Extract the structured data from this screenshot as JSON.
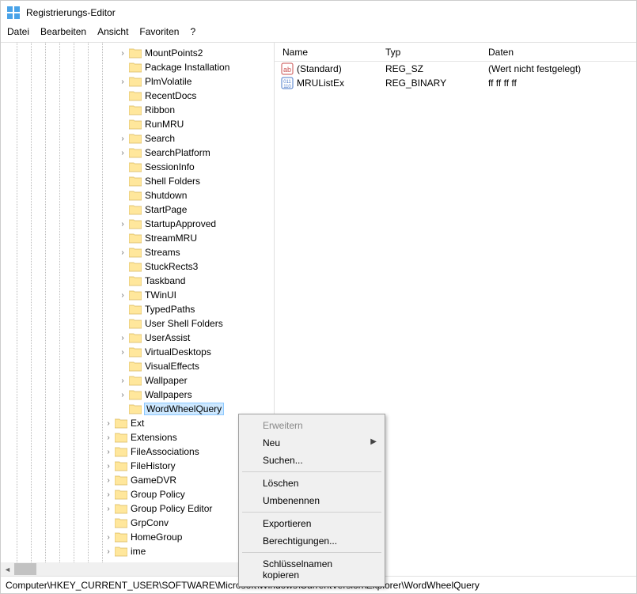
{
  "window": {
    "title": "Registrierungs-Editor"
  },
  "menu": {
    "file": "Datei",
    "edit": "Bearbeiten",
    "view": "Ansicht",
    "favorites": "Favoriten",
    "help": "?"
  },
  "tree": {
    "itemsTop": [
      {
        "label": "MountPoints2",
        "expander": ">",
        "indent": 148
      },
      {
        "label": "Package Installation",
        "expander": "",
        "indent": 148
      },
      {
        "label": "PlmVolatile",
        "expander": ">",
        "indent": 148
      },
      {
        "label": "RecentDocs",
        "expander": "",
        "indent": 148
      },
      {
        "label": "Ribbon",
        "expander": "",
        "indent": 148
      },
      {
        "label": "RunMRU",
        "expander": "",
        "indent": 148
      },
      {
        "label": "Search",
        "expander": ">",
        "indent": 148
      },
      {
        "label": "SearchPlatform",
        "expander": ">",
        "indent": 148
      },
      {
        "label": "SessionInfo",
        "expander": "",
        "indent": 148
      },
      {
        "label": "Shell Folders",
        "expander": "",
        "indent": 148
      },
      {
        "label": "Shutdown",
        "expander": "",
        "indent": 148
      },
      {
        "label": "StartPage",
        "expander": "",
        "indent": 148
      },
      {
        "label": "StartupApproved",
        "expander": ">",
        "indent": 148
      },
      {
        "label": "StreamMRU",
        "expander": "",
        "indent": 148
      },
      {
        "label": "Streams",
        "expander": ">",
        "indent": 148
      },
      {
        "label": "StuckRects3",
        "expander": "",
        "indent": 148
      },
      {
        "label": "Taskband",
        "expander": "",
        "indent": 148
      },
      {
        "label": "TWinUI",
        "expander": ">",
        "indent": 148
      },
      {
        "label": "TypedPaths",
        "expander": "",
        "indent": 148
      },
      {
        "label": "User Shell Folders",
        "expander": "",
        "indent": 148
      },
      {
        "label": "UserAssist",
        "expander": ">",
        "indent": 148
      },
      {
        "label": "VirtualDesktops",
        "expander": ">",
        "indent": 148
      },
      {
        "label": "VisualEffects",
        "expander": "",
        "indent": 148
      },
      {
        "label": "Wallpaper",
        "expander": ">",
        "indent": 148
      },
      {
        "label": "Wallpapers",
        "expander": ">",
        "indent": 148
      },
      {
        "label": "WordWheelQuery",
        "expander": "",
        "indent": 148,
        "selected": true
      }
    ],
    "itemsLower": [
      {
        "label": "Ext",
        "expander": ">",
        "indent": 130
      },
      {
        "label": "Extensions",
        "expander": ">",
        "indent": 130
      },
      {
        "label": "FileAssociations",
        "expander": ">",
        "indent": 130
      },
      {
        "label": "FileHistory",
        "expander": ">",
        "indent": 130
      },
      {
        "label": "GameDVR",
        "expander": ">",
        "indent": 130
      },
      {
        "label": "Group Policy",
        "expander": ">",
        "indent": 130
      },
      {
        "label": "Group Policy Editor",
        "expander": ">",
        "indent": 130
      },
      {
        "label": "GrpConv",
        "expander": "",
        "indent": 130
      },
      {
        "label": "HomeGroup",
        "expander": ">",
        "indent": 130
      },
      {
        "label": "ime",
        "expander": ">",
        "indent": 130
      }
    ]
  },
  "listHeader": {
    "name": "Name",
    "type": "Typ",
    "data": "Daten"
  },
  "listRows": [
    {
      "icon": "string",
      "name": "(Standard)",
      "type": "REG_SZ",
      "data": "(Wert nicht festgelegt)"
    },
    {
      "icon": "binary",
      "name": "MRUListEx",
      "type": "REG_BINARY",
      "data": "ff ff ff ff"
    }
  ],
  "contextMenu": {
    "expand": "Erweitern",
    "new": "Neu",
    "search": "Suchen...",
    "delete": "Löschen",
    "rename": "Umbenennen",
    "export": "Exportieren",
    "permissions": "Berechtigungen...",
    "copyKey": "Schlüsselnamen kopieren"
  },
  "statusbar": {
    "path": "Computer\\HKEY_CURRENT_USER\\SOFTWARE\\Microsoft\\Windows\\CurrentVersion\\Explorer\\WordWheelQuery"
  }
}
